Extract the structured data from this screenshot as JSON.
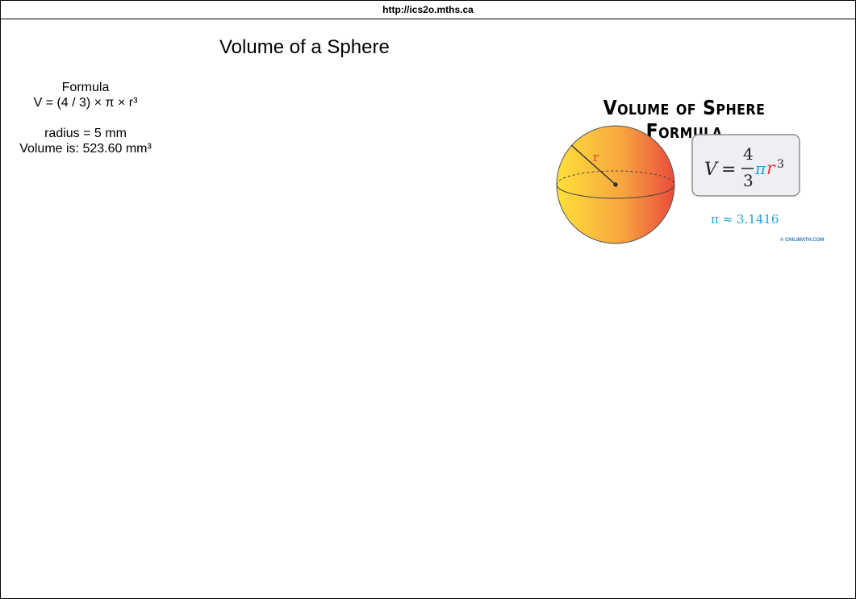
{
  "url": "http://ics2o.mths.ca",
  "page_title": "Volume of a Sphere",
  "panel": {
    "heading": "Formula",
    "formula": "V = (4 / 3) × π × r³",
    "radius_line": "radius = 5 mm",
    "volume_line": "Volume is: 523.60 mm³"
  },
  "figure": {
    "title": "Volume of Sphere Formula",
    "radius_label": "r",
    "formula_v": "V",
    "formula_eq": "=",
    "formula_num": "4",
    "formula_den": "3",
    "formula_pi": "π",
    "formula_r": "r",
    "formula_exp": "3",
    "pi_approx": "π ≈ 3.1416",
    "credit": "© CHILIMATH.COM",
    "colors": {
      "sphere_left": "#ffe03a",
      "sphere_mid": "#f7a640",
      "sphere_right": "#ea4a3c",
      "pi_blue": "#1ea3e0",
      "r_red": "#e53935",
      "box_fill": "#eeeff2",
      "box_border": "#8c8c8c"
    }
  }
}
